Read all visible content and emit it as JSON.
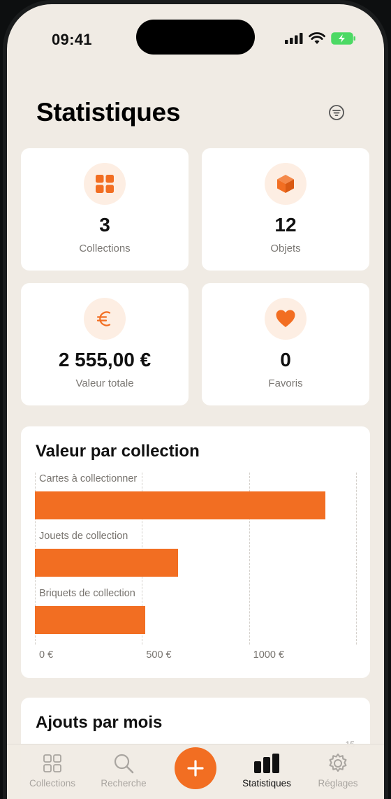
{
  "status": {
    "time": "09:41"
  },
  "header": {
    "title": "Statistiques"
  },
  "stats": [
    {
      "value": "3",
      "label": "Collections",
      "icon": "grid-icon"
    },
    {
      "value": "12",
      "label": "Objets",
      "icon": "box-icon"
    },
    {
      "value": "2 555,00 €",
      "label": "Valeur totale",
      "icon": "euro-icon"
    },
    {
      "value": "0",
      "label": "Favoris",
      "icon": "heart-icon"
    }
  ],
  "chart_data": {
    "type": "bar",
    "orientation": "horizontal",
    "title": "Valeur par collection",
    "categories": [
      "Cartes à collectionner",
      "Jouets de collection",
      "Briquets de collection"
    ],
    "values": [
      1355,
      670,
      515
    ],
    "unit": "€",
    "xlim": [
      0,
      1500
    ],
    "ticks": [
      "0 €",
      "500 €",
      "1000 €"
    ],
    "grid": true,
    "bar_color": "#f26e22"
  },
  "monthly": {
    "title": "Ajouts par mois",
    "tick": "15"
  },
  "tabbar": {
    "items": [
      {
        "label": "Collections",
        "icon": "grid-icon"
      },
      {
        "label": "Recherche",
        "icon": "search-icon"
      },
      {
        "label": "Statistiques",
        "icon": "bar-chart-icon",
        "active": true
      },
      {
        "label": "Réglages",
        "icon": "gear-icon"
      }
    ],
    "add_icon": "plus-icon"
  },
  "colors": {
    "accent": "#f26e22",
    "background": "#f0ebe4",
    "card": "#ffffff",
    "icon_bg": "#fdeee3"
  }
}
